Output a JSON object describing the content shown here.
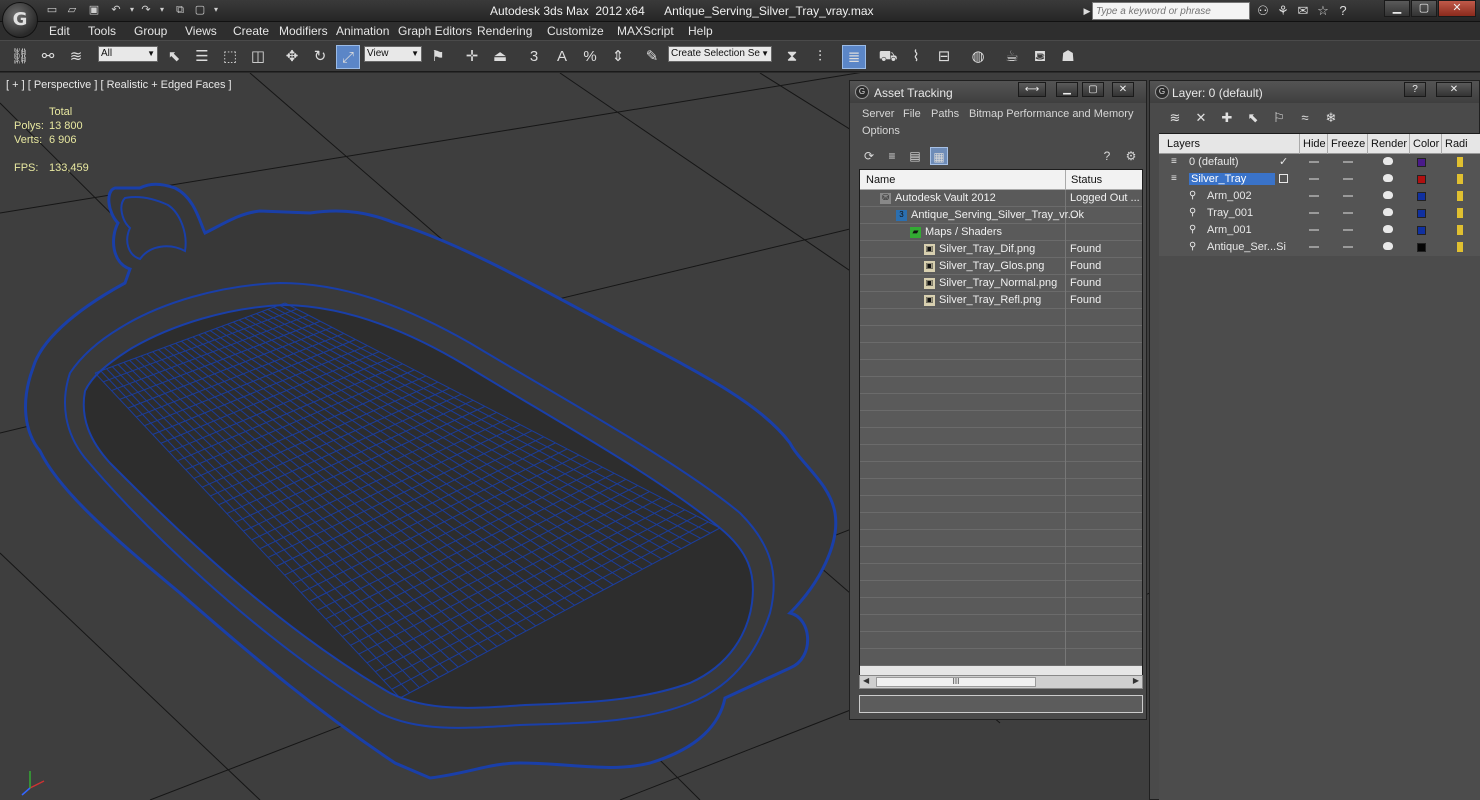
{
  "app": {
    "logo": "G",
    "title": "Autodesk 3ds Max  2012 x64      Antique_Serving_Silver_Tray_vray.max",
    "search_placeholder": "Type a keyword or phrase"
  },
  "menu": [
    "Edit",
    "Tools",
    "Group",
    "Views",
    "Create",
    "Modifiers",
    "Animation",
    "Graph Editors",
    "Rendering",
    "Customize",
    "MAXScript",
    "Help"
  ],
  "toolbar": {
    "filter_value": "All",
    "refcoord_value": "View",
    "selection_set_value": "Create Selection Se",
    "snap_label": "3",
    "angle_label": "A",
    "percent_label": "%"
  },
  "viewport": {
    "label": "[ + ] [ Perspective ] [ Realistic + Edged Faces ]",
    "stats": {
      "total_label": "Total",
      "polys_label": "Polys:",
      "polys_value": "13 800",
      "verts_label": "Verts:",
      "verts_value": "6 906",
      "fps_label": "FPS:",
      "fps_value": "133,459"
    },
    "wire_color": "#1a3fa8"
  },
  "asset_tracking": {
    "title": "Asset Tracking",
    "menu": [
      "Server",
      "File",
      "Paths",
      "Bitmap Performance and Memory",
      "Options"
    ],
    "columns": [
      "Name",
      "Status"
    ],
    "rows": [
      {
        "name": "Autodesk Vault 2012",
        "status": "Logged Out ..."
      },
      {
        "name": "Antique_Serving_Silver_Tray_vr...",
        "status": "Ok"
      },
      {
        "name": "Maps / Shaders",
        "status": ""
      },
      {
        "name": "Silver_Tray_Dif.png",
        "status": "Found"
      },
      {
        "name": "Silver_Tray_Glos.png",
        "status": "Found"
      },
      {
        "name": "Silver_Tray_Normal.png",
        "status": "Found"
      },
      {
        "name": "Silver_Tray_Refl.png",
        "status": "Found"
      }
    ],
    "scroll_thumb": "III"
  },
  "layer_panel": {
    "title": "Layer: 0 (default)",
    "columns": [
      "Layers",
      "Hide",
      "Freeze",
      "Render",
      "Color",
      "Radi"
    ],
    "rows": [
      {
        "name": "0 (default)",
        "color": "#4a1a8a",
        "current": true
      },
      {
        "name": "Silver_Tray",
        "color": "#b01010",
        "selected": true
      },
      {
        "name": "Arm_002",
        "color": "#1030a0"
      },
      {
        "name": "Tray_001",
        "color": "#1030a0"
      },
      {
        "name": "Arm_001",
        "color": "#1030a0"
      },
      {
        "name": "Antique_Ser...Si",
        "color": "#050505"
      }
    ]
  }
}
